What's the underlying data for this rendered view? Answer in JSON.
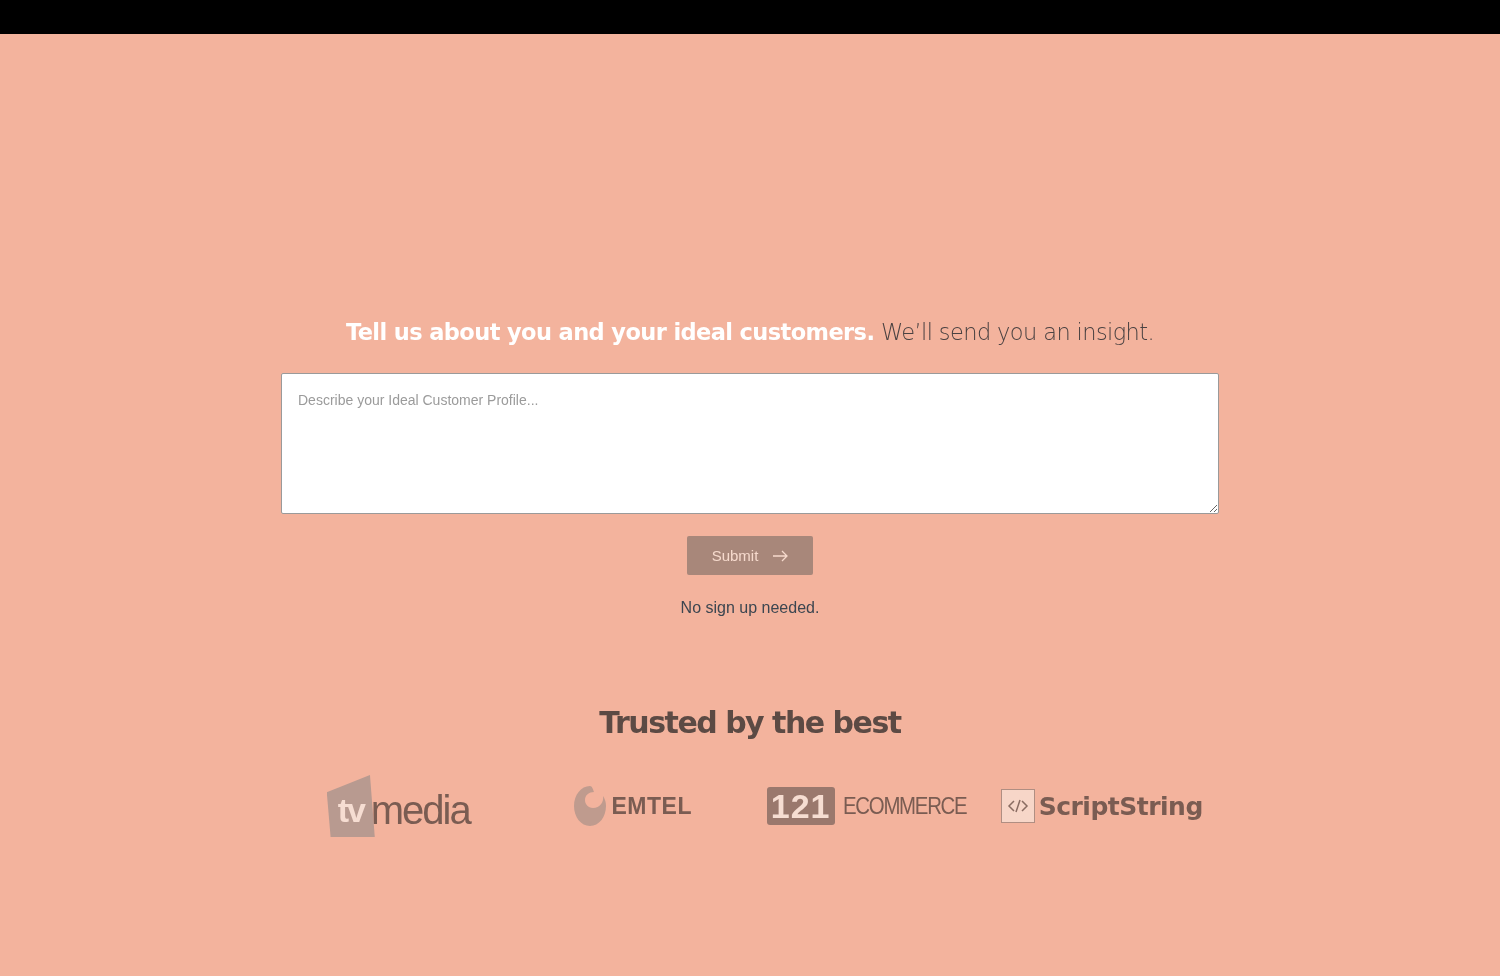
{
  "headline": "**Tell us about you and your ideal customers.** We’ll send you an insight.",
  "profile_field": {
    "placeholder": "Describe your Ideal Customer Profile..."
  },
  "submit_button": {
    "label": "Submit"
  },
  "note": "No sign up needed.",
  "trusted_section": {
    "title": "Trusted by the best",
    "logos": [
      {
        "kind": "tile",
        "mark": "tv",
        "name": "media"
      },
      {
        "kind": "swirl",
        "name": "EMTEL"
      },
      {
        "kind": "digits",
        "mark": "121",
        "name": "ECOMMERCE"
      },
      {
        "kind": "code",
        "name": "ScriptString"
      }
    ]
  }
}
